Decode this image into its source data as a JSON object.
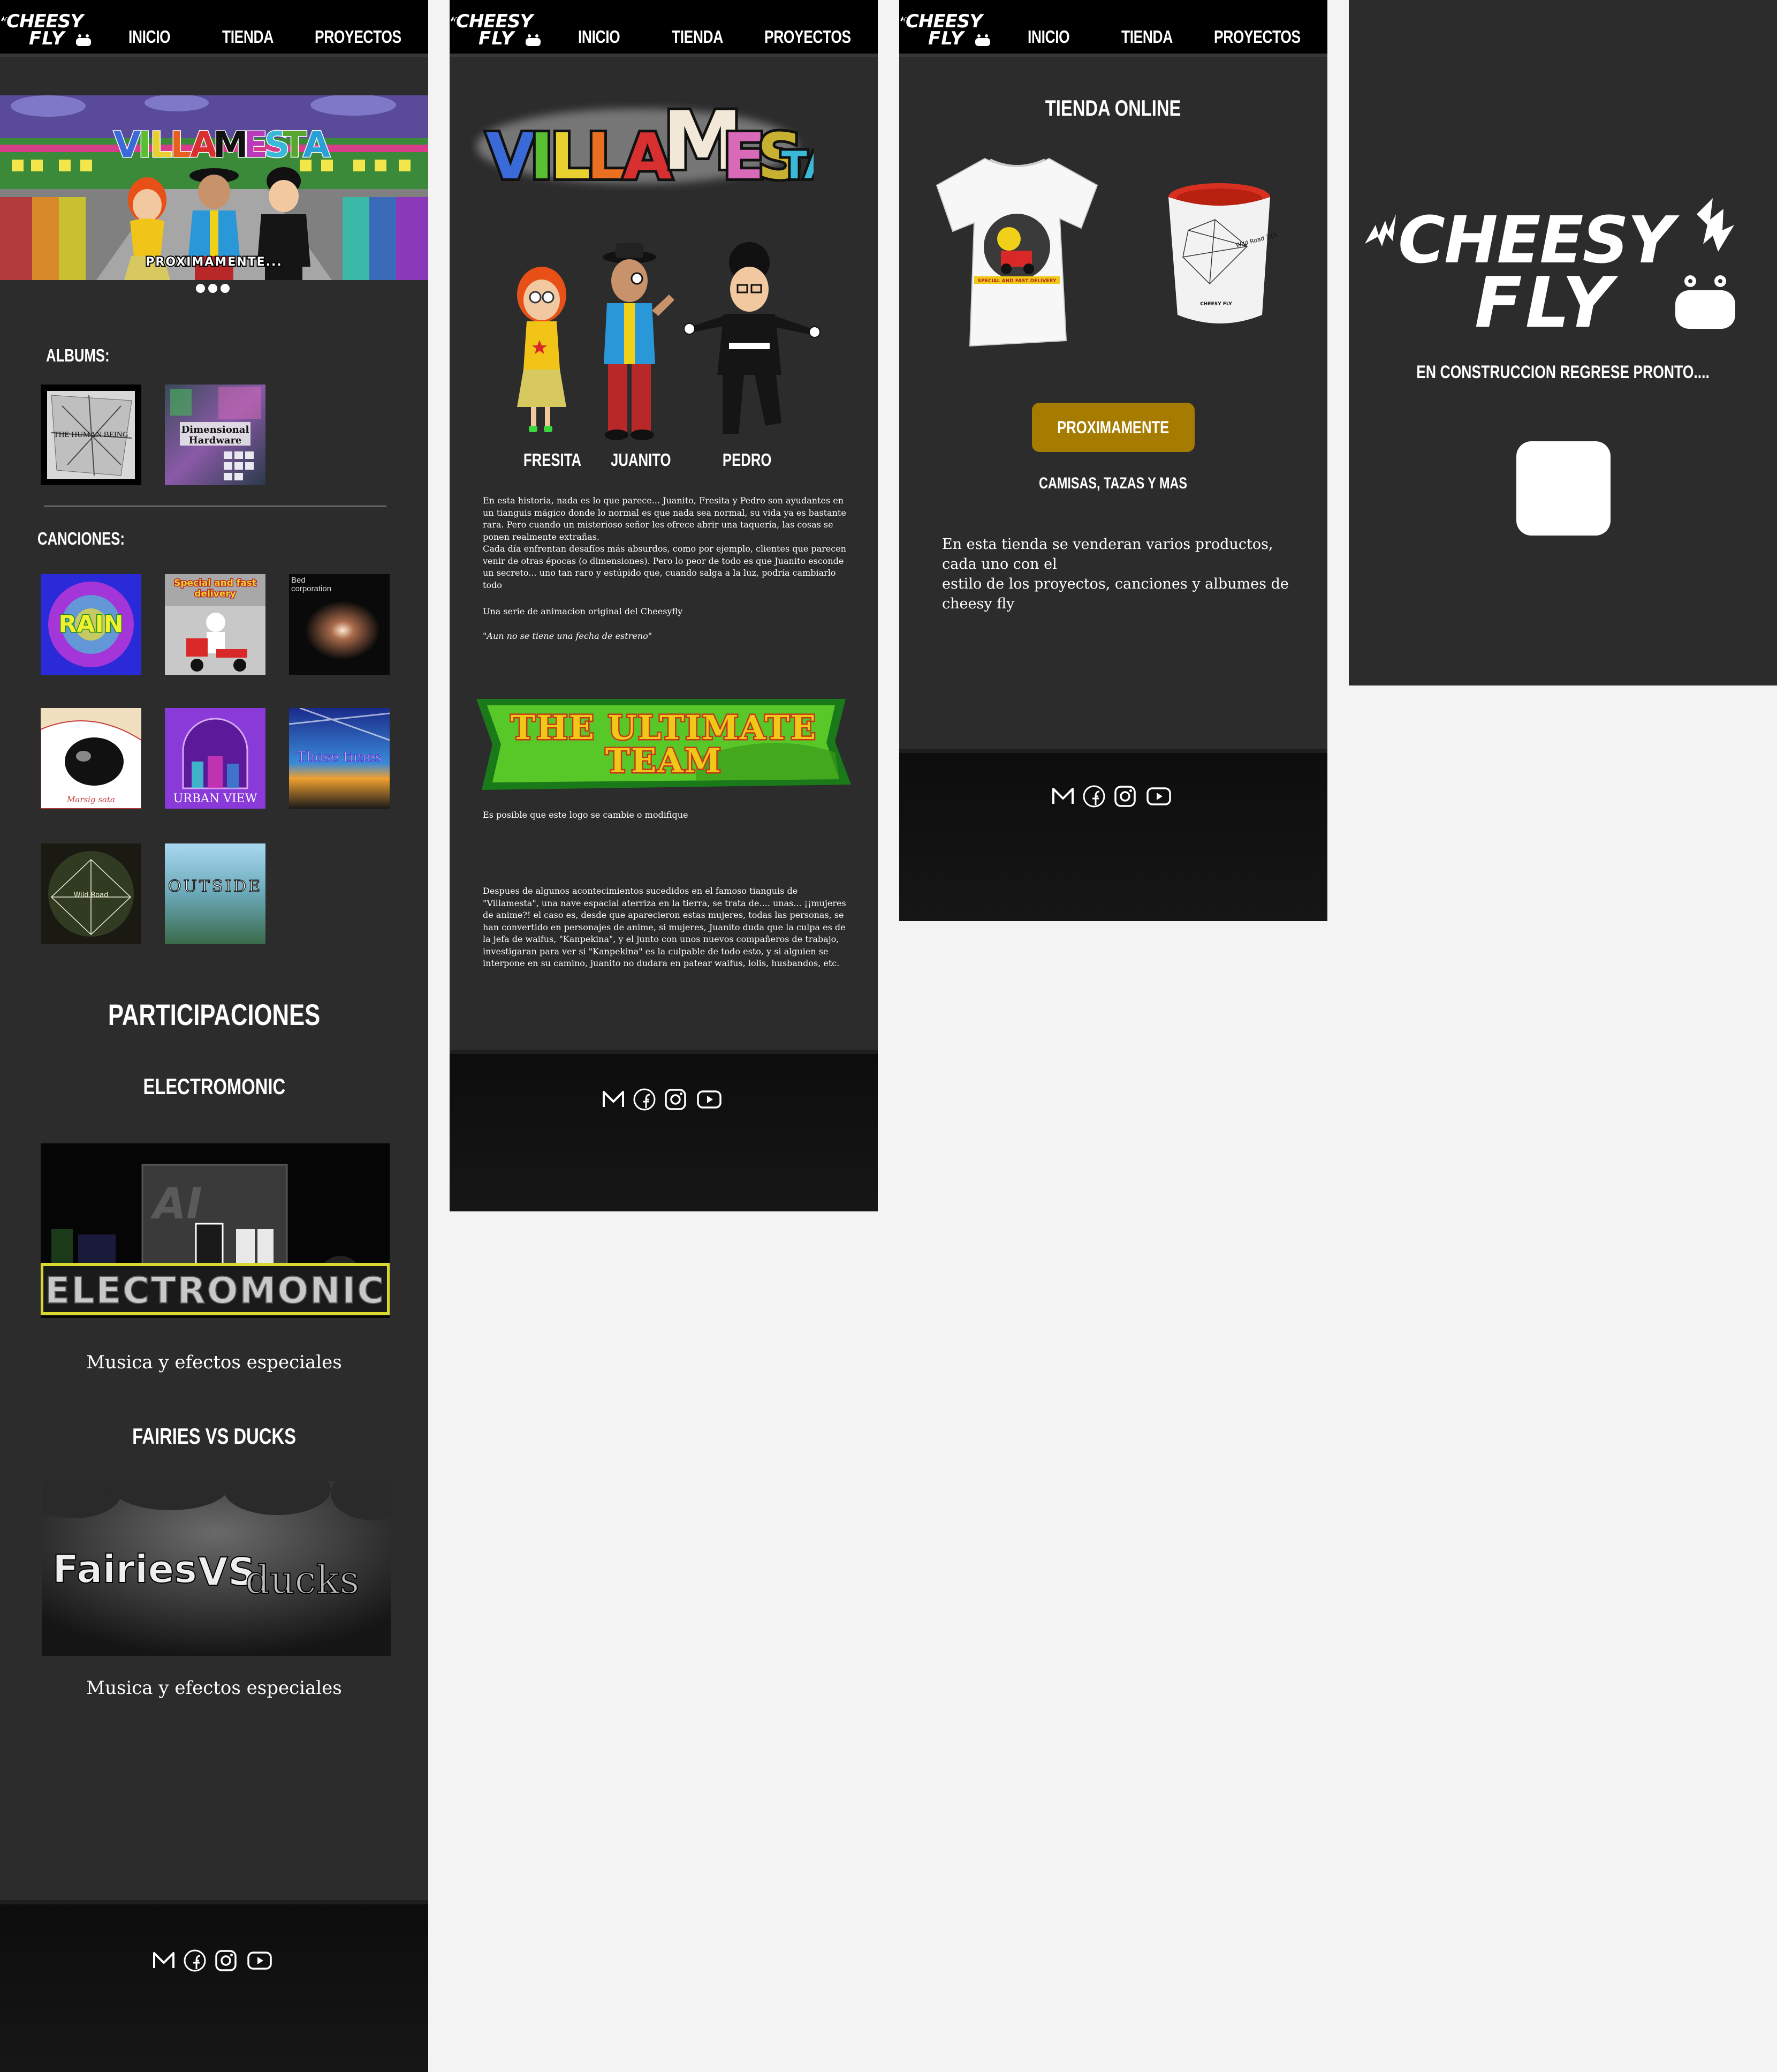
{
  "nav": {
    "brand_line1": "CHEESY",
    "brand_line2": "FLY",
    "links": [
      "INICIO",
      "TIENDA",
      "PROYECTOS"
    ]
  },
  "home": {
    "hero": {
      "title": "VILLAMESTA",
      "caption": "PROXIMAMENTE...",
      "slides": 3,
      "active_slide": 1
    },
    "albums_label": "ALBUMS:",
    "albums": [
      {
        "title": "THE HUMAN BEING"
      },
      {
        "title": "Dimensional Hardware"
      }
    ],
    "songs_label": "CANCIONES:",
    "songs": [
      {
        "title": "RAIN"
      },
      {
        "title": "Special and fast delivery"
      },
      {
        "title": "Bed corporation"
      },
      {
        "title": "Marsig sata"
      },
      {
        "title": "URBAN VIEW"
      },
      {
        "title": "Those times"
      },
      {
        "title": "Wild Road"
      },
      {
        "title": "OUTSIDE"
      }
    ],
    "participations_title": "PARTICIPACIONES",
    "participations": [
      {
        "name": "ELECTROMONIC",
        "banner_text": "ELECTROMONIC",
        "banner_tag": "AI",
        "caption": "Musica y efectos especiales"
      },
      {
        "name": "FAIRIES VS DUCKS",
        "banner_text_a": "Fairies",
        "banner_text_b": "VS",
        "banner_text_c": "ducks",
        "caption": "Musica y efectos especiales"
      }
    ]
  },
  "projects": {
    "logo": "VILLAMESTA",
    "characters": [
      "FRESITA",
      "JUANITO",
      "PEDRO"
    ],
    "story": "En esta historia, nada es lo que parece... Juanito, Fresita y Pedro son ayudantes en un tianguis mágico donde lo normal es que nada sea normal, su vida ya es bastante rara. Pero cuando un misterioso señor les ofrece abrir una taquería, las cosas se ponen realmente extrañas.",
    "story2": "Cada día enfrentan desafíos más absurdos, como por ejemplo, clientes que parecen venir de otras épocas (o dimensiones). Pero lo peor de todo es que Juanito esconde un secreto... uno tan raro y estúpido que, cuando salga a la luz, podría cambiarlo todo",
    "series_note": "Una serie de animacion original del Cheesyfly",
    "release_note": "\"Aun no se tiene una fecha de estreno\"",
    "team_logo": "THE ULTIMATE TEAM",
    "team_note": "Es posible que este logo se cambie o modifique",
    "team_story": "Despues de algunos acontecimientos sucedidos en el famoso tianguis de \"Villamesta\", una nave espacial aterriza en la tierra, se trata de.... unas... ¡¡mujeres de anime?!  el caso es, desde que aparecieron estas mujeres, todas las personas, se han convertido en personajes de anime, si mujeres, Juanito duda que la culpa es de la jefa de waifus, \"Kanpekina\", y el junto con unos nuevos compañeros de trabajo, investigaran para ver si \"Kanpekina\" es la culpable de todo esto, y si alguien se interpone en su camino, juanito no dudara en patear waifus, lolis, husbandos, etc."
  },
  "store": {
    "title": "TIENDA ONLINE",
    "button": "PROXIMAMENTE",
    "subtitle": "CAMISAS, TAZAS Y MAS",
    "shirt_print": "SPECIAL AND FAST DELIVERY",
    "mug_print": "Wild Road 315",
    "mug_brand": "CHEESY FLY",
    "body_lines": [
      "En esta tienda se venderan varios productos,",
      "cada uno con el",
      "estilo de los proyectos, canciones y albumes de",
      "cheesy fly"
    ]
  },
  "construction": {
    "logo_line1": "CHEESY",
    "logo_line2": "FLY",
    "message": "EN CONSTRUCCION REGRESE PRONTO...."
  },
  "colors": {
    "frame": "#2c2c2c",
    "nav": "#000000",
    "button": "#a67c00",
    "canvas": "#f3f3f3"
  },
  "social_icons": [
    "mail-icon",
    "facebook-icon",
    "instagram-icon",
    "youtube-icon"
  ]
}
